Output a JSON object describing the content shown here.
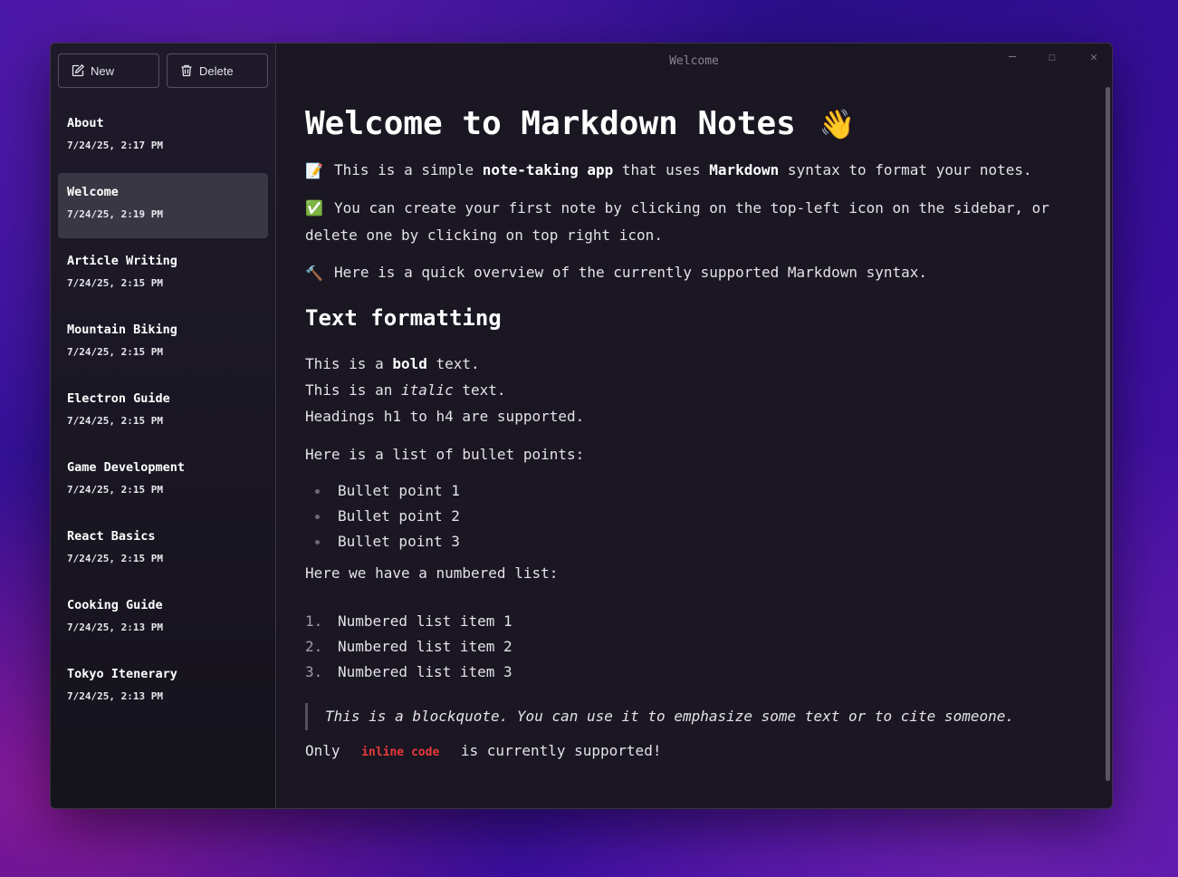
{
  "window": {
    "title": "Welcome",
    "controls": {
      "minimize": "─",
      "maximize": "☐",
      "close": "✕"
    }
  },
  "toolbar": {
    "new_label": "New",
    "delete_label": "Delete"
  },
  "notes": [
    {
      "title": "About",
      "date": "7/24/25, 2:17 PM"
    },
    {
      "title": "Welcome",
      "date": "7/24/25, 2:19 PM"
    },
    {
      "title": "Article Writing",
      "date": "7/24/25, 2:15 PM"
    },
    {
      "title": "Mountain Biking",
      "date": "7/24/25, 2:15 PM"
    },
    {
      "title": "Electron Guide",
      "date": "7/24/25, 2:15 PM"
    },
    {
      "title": "Game Development",
      "date": "7/24/25, 2:15 PM"
    },
    {
      "title": "React Basics",
      "date": "7/24/25, 2:15 PM"
    },
    {
      "title": "Cooking Guide",
      "date": "7/24/25, 2:13 PM"
    },
    {
      "title": "Tokyo Itenerary",
      "date": "7/24/25, 2:13 PM"
    }
  ],
  "content": {
    "h1": "Welcome to Markdown Notes",
    "h1_emoji": "👋",
    "p1": {
      "emoji": "📝",
      "a": "This is a simple ",
      "b1": "note-taking app",
      "c": " that uses ",
      "b2": "Markdown",
      "d": " syntax to format your notes."
    },
    "p2": {
      "emoji": "✅",
      "text": "You can create your first note by clicking on the top-left icon on the sidebar, or delete one by clicking on top right icon."
    },
    "p3": {
      "emoji": "🔨",
      "text": "Here is a quick overview of the currently supported Markdown syntax."
    },
    "h2": "Text formatting",
    "bold_line": {
      "a": "This is a ",
      "b": "bold",
      "c": " text."
    },
    "italic_line": {
      "a": "This is an ",
      "i": "italic",
      "c": " text."
    },
    "headings_line": "Headings h1 to h4 are supported.",
    "bullet_intro": "Here is a list of bullet points:",
    "bullets": [
      "Bullet point 1",
      "Bullet point 2",
      "Bullet point 3"
    ],
    "numbered_intro": "Here we have a numbered list:",
    "numbered": [
      {
        "n": "1.",
        "text": "Numbered list item 1"
      },
      {
        "n": "2.",
        "text": "Numbered list item 2"
      },
      {
        "n": "3.",
        "text": "Numbered list item 3"
      }
    ],
    "blockquote": "This is a blockquote. You can use it to emphasize some text or to cite someone.",
    "code_line": {
      "a": "Only ",
      "code": "inline code",
      "c": " is currently supported!"
    }
  },
  "colors": {
    "accent_code": "#e83a3a",
    "active_note_bg": "#3a3744"
  }
}
